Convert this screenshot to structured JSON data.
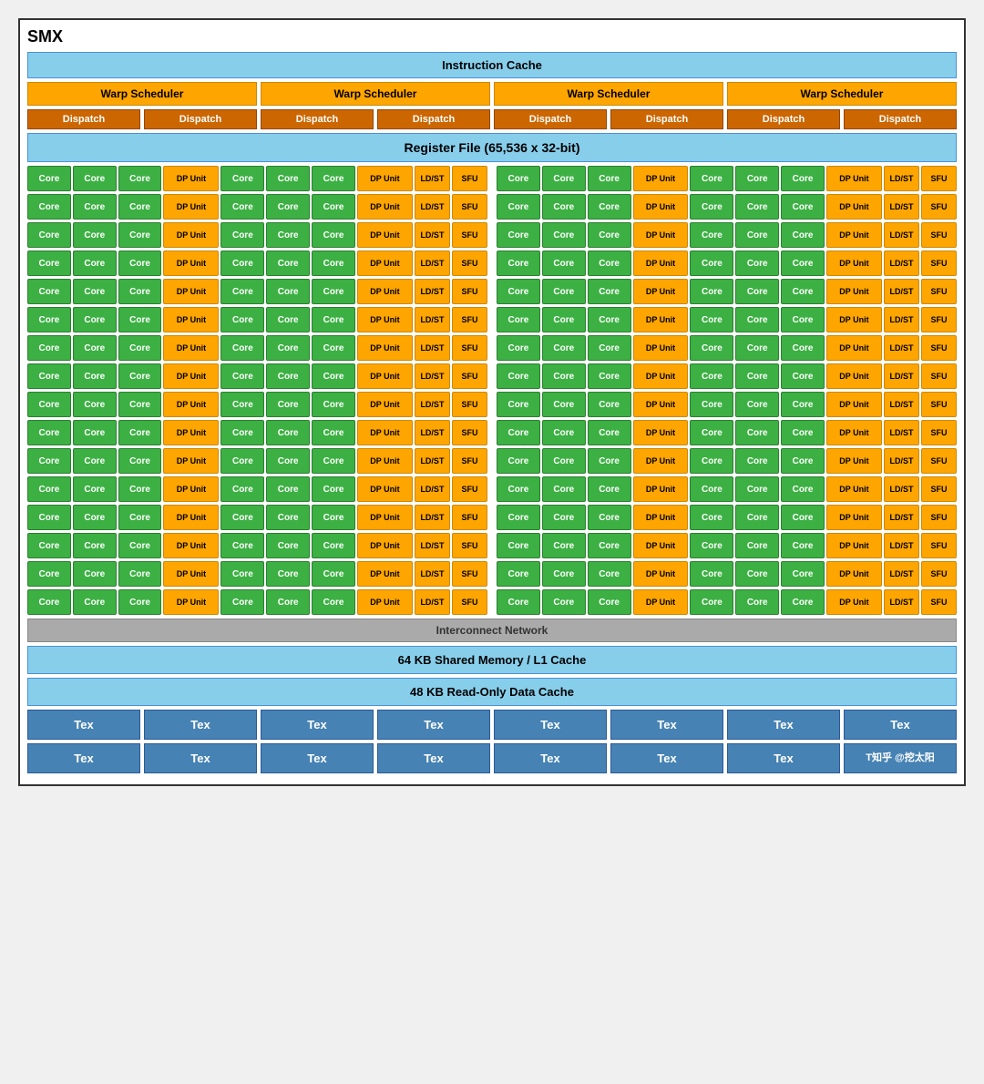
{
  "title": "SMX",
  "instruction_cache": "Instruction Cache",
  "warp_schedulers": [
    "Warp Scheduler",
    "Warp Scheduler",
    "Warp Scheduler",
    "Warp Scheduler"
  ],
  "dispatch_units": [
    "Dispatch",
    "Dispatch",
    "Dispatch",
    "Dispatch",
    "Dispatch",
    "Dispatch",
    "Dispatch",
    "Dispatch"
  ],
  "register_file": "Register File (65,536 x 32-bit)",
  "core_rows": 16,
  "interconnect": "Interconnect Network",
  "shared_memory": "64 KB Shared Memory / L1 Cache",
  "readonly_cache": "48 KB Read-Only Data Cache",
  "tex_rows": [
    [
      "Tex",
      "Tex",
      "Tex",
      "Tex",
      "Tex",
      "Tex",
      "Tex",
      "Tex"
    ],
    [
      "Tex",
      "Tex",
      "Tex",
      "Tex",
      "Tex",
      "Tex",
      "T知乎 @挖太阳",
      ""
    ]
  ],
  "colors": {
    "core": "#3cb043",
    "dp_unit": "#FFA500",
    "ldst": "#FFA500",
    "sfu": "#FFA500",
    "warp": "#FFA500",
    "dispatch": "#cc6600",
    "cache": "#87CEEB",
    "tex": "#4682B4",
    "interconnect": "#aaaaaa"
  }
}
